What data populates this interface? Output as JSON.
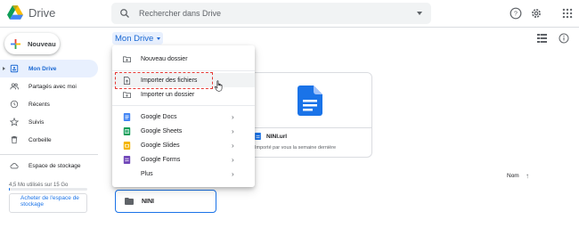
{
  "app": {
    "title": "Drive"
  },
  "search": {
    "placeholder": "Rechercher dans Drive"
  },
  "header": {
    "icons": [
      "help-icon",
      "settings-icon",
      "apps-grid-icon",
      "list-view-icon",
      "info-icon"
    ]
  },
  "sidebar": {
    "new_label": "Nouveau",
    "items": [
      {
        "label": "Mon Drive",
        "icon": "my-drive-icon",
        "active": true
      },
      {
        "label": "Partagés avec moi",
        "icon": "shared-icon"
      },
      {
        "label": "Récents",
        "icon": "clock-icon"
      },
      {
        "label": "Suivis",
        "icon": "star-icon"
      },
      {
        "label": "Corbeille",
        "icon": "trash-icon"
      }
    ],
    "storage": {
      "label": "Espace de stockage",
      "used_text": "4,5 Mo utilisés sur 15 Go",
      "used_fraction": 0.0003,
      "buy_label": "Acheter de l'espace de stockage"
    }
  },
  "breadcrumb": {
    "label": "Mon Drive"
  },
  "menu": {
    "items": [
      {
        "label": "Nouveau dossier",
        "icon": "new-folder-icon"
      },
      {
        "label": "Importer des fichiers",
        "icon": "file-upload-icon",
        "highlighted": true
      },
      {
        "label": "Importer un dossier",
        "icon": "folder-upload-icon"
      },
      {
        "label": "Google Docs",
        "icon": "google-docs-icon",
        "color": "#4285f4",
        "submenu": true
      },
      {
        "label": "Google Sheets",
        "icon": "google-sheets-icon",
        "color": "#0f9d58",
        "submenu": true
      },
      {
        "label": "Google Slides",
        "icon": "google-slides-icon",
        "color": "#f4b400",
        "submenu": true
      },
      {
        "label": "Google Forms",
        "icon": "google-forms-icon",
        "color": "#7248b9",
        "submenu": true
      },
      {
        "label": "Plus",
        "icon": "",
        "submenu": true
      }
    ]
  },
  "file_card": {
    "name": "NINI.url",
    "subtitle": "Importé par vous la semaine dernière",
    "icon": "doc-icon"
  },
  "sort": {
    "label": "Nom",
    "direction": "ascending"
  },
  "folder": {
    "name": "NINI"
  },
  "colors": {
    "accent": "#1a73e8",
    "active_bg": "#e8f0fe",
    "highlight_border": "#e53935",
    "doc_blue": "#1a73e8"
  }
}
